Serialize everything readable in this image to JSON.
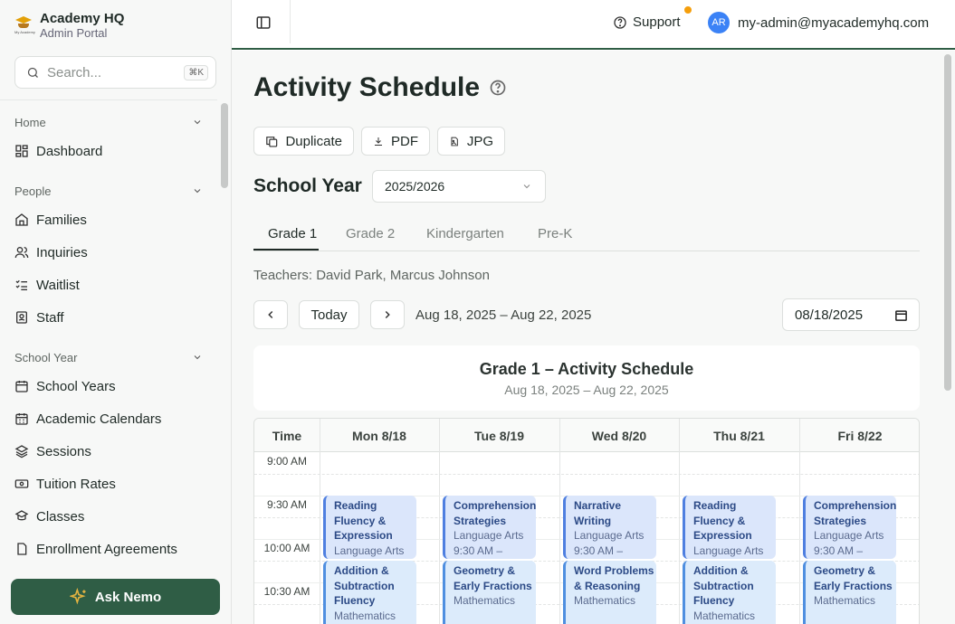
{
  "brand": {
    "title": "Academy HQ",
    "subtitle": "Admin Portal",
    "logo_text": "My Academy"
  },
  "search": {
    "placeholder": "Search...",
    "shortcut": "⌘K"
  },
  "sidebar": {
    "sections": [
      {
        "label": "Home",
        "items": [
          {
            "label": "Dashboard",
            "icon": "dashboard-icon"
          }
        ]
      },
      {
        "label": "People",
        "items": [
          {
            "label": "Families",
            "icon": "home-icon"
          },
          {
            "label": "Inquiries",
            "icon": "users-icon"
          },
          {
            "label": "Waitlist",
            "icon": "list-check-icon"
          },
          {
            "label": "Staff",
            "icon": "badge-icon"
          }
        ]
      },
      {
        "label": "School Year",
        "items": [
          {
            "label": "School Years",
            "icon": "calendar-icon"
          },
          {
            "label": "Academic Calendars",
            "icon": "calendar-days-icon"
          },
          {
            "label": "Sessions",
            "icon": "layers-icon"
          },
          {
            "label": "Tuition Rates",
            "icon": "banknote-icon"
          },
          {
            "label": "Classes",
            "icon": "classes-icon"
          },
          {
            "label": "Enrollment Agreements",
            "icon": "file-icon"
          }
        ]
      }
    ]
  },
  "ask_button": {
    "label": "Ask Nemo"
  },
  "topbar": {
    "support_label": "Support",
    "user_initials": "AR",
    "user_email": "my-admin@myacademyhq.com"
  },
  "page": {
    "title": "Activity Schedule",
    "actions": {
      "duplicate": "Duplicate",
      "pdf": "PDF",
      "jpg": "JPG"
    },
    "school_year_label": "School Year",
    "school_year_value": "2025/2026",
    "tabs": [
      "Grade 1",
      "Grade 2",
      "Kindergarten",
      "Pre-K"
    ],
    "active_tab": "Grade 1",
    "teachers": "Teachers: David Park, Marcus Johnson",
    "today_label": "Today",
    "date_range": "Aug 18, 2025 – Aug 22, 2025",
    "date_input": "08/18/2025"
  },
  "schedule": {
    "title": "Grade 1 – Activity Schedule",
    "subtitle": "Aug 18, 2025 – Aug 22, 2025",
    "time_header": "Time",
    "days": [
      "Mon 8/18",
      "Tue 8/19",
      "Wed 8/20",
      "Thu 8/21",
      "Fri 8/22"
    ],
    "times": [
      "9:00 AM",
      "9:30 AM",
      "10:00 AM",
      "10:30 AM"
    ],
    "morning_block": [
      {
        "title": "Reading Fluency & Expression",
        "sub": "Language Arts",
        "type": "la"
      },
      {
        "title": "Comprehension Strategies",
        "sub": "Language Arts",
        "time": "9:30 AM –",
        "type": "la"
      },
      {
        "title": "Narrative Writing",
        "sub": "Language Arts",
        "time": "9:30 AM –",
        "type": "la"
      },
      {
        "title": "Reading Fluency & Expression",
        "sub": "Language Arts",
        "type": "la"
      },
      {
        "title": "Comprehension Strategies",
        "sub": "Language Arts",
        "time": "9:30 AM –",
        "type": "la"
      }
    ],
    "second_block": [
      {
        "title": "Addition & Subtraction Fluency",
        "sub": "Mathematics",
        "type": "math"
      },
      {
        "title": "Geometry & Early Fractions",
        "sub": "Mathematics",
        "type": "math"
      },
      {
        "title": "Word Problems & Reasoning",
        "sub": "Mathematics",
        "type": "math"
      },
      {
        "title": "Addition & Subtraction Fluency",
        "sub": "Mathematics",
        "type": "math"
      },
      {
        "title": "Geometry & Early Fractions",
        "sub": "Mathematics",
        "type": "math"
      }
    ]
  },
  "colors": {
    "brand_green": "#2f5d45",
    "accent_orange": "#f59e0b",
    "avatar_blue": "#3b82f6",
    "event_blue": "#dbe6fb"
  }
}
